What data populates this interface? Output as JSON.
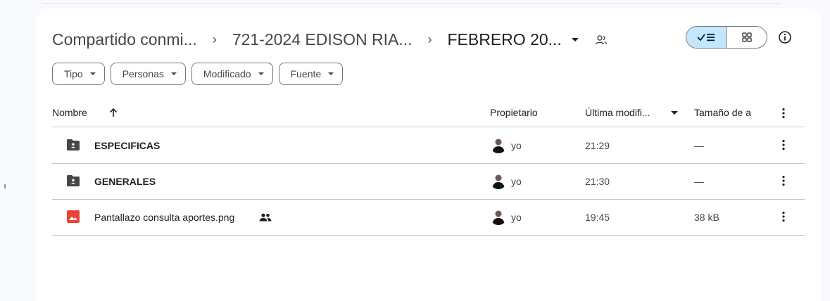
{
  "breadcrumb": {
    "items": [
      "Compartido conmi...",
      "721-2024 EDISON RIA...",
      "FEBRERO 20..."
    ],
    "separator": "›"
  },
  "view_toggle": {
    "selected": "list",
    "options": [
      "list",
      "grid"
    ]
  },
  "filters": [
    {
      "label": "Tipo"
    },
    {
      "label": "Personas"
    },
    {
      "label": "Modificado"
    },
    {
      "label": "Fuente"
    }
  ],
  "table": {
    "columns": {
      "name": "Nombre",
      "owner": "Propietario",
      "modified": "Última modifi...",
      "size": "Tamaño de a"
    },
    "sort": {
      "column": "name",
      "direction": "ascending"
    },
    "rows": [
      {
        "name": "ESPECIFICAS",
        "type": "shared-folder",
        "owner": "yo",
        "modified": "21:29",
        "size": "—"
      },
      {
        "name": "GENERALES",
        "type": "shared-folder",
        "owner": "yo",
        "modified": "21:30",
        "size": "—"
      },
      {
        "name": "Pantallazo consulta aportes.png",
        "type": "image",
        "shared": true,
        "owner": "yo",
        "modified": "19:45",
        "size": "38 kB"
      }
    ]
  },
  "colors": {
    "accent": "#c2e7ff",
    "folder": "#444746",
    "image_icon": "#ea4335",
    "divider": "#c4c7c5"
  }
}
